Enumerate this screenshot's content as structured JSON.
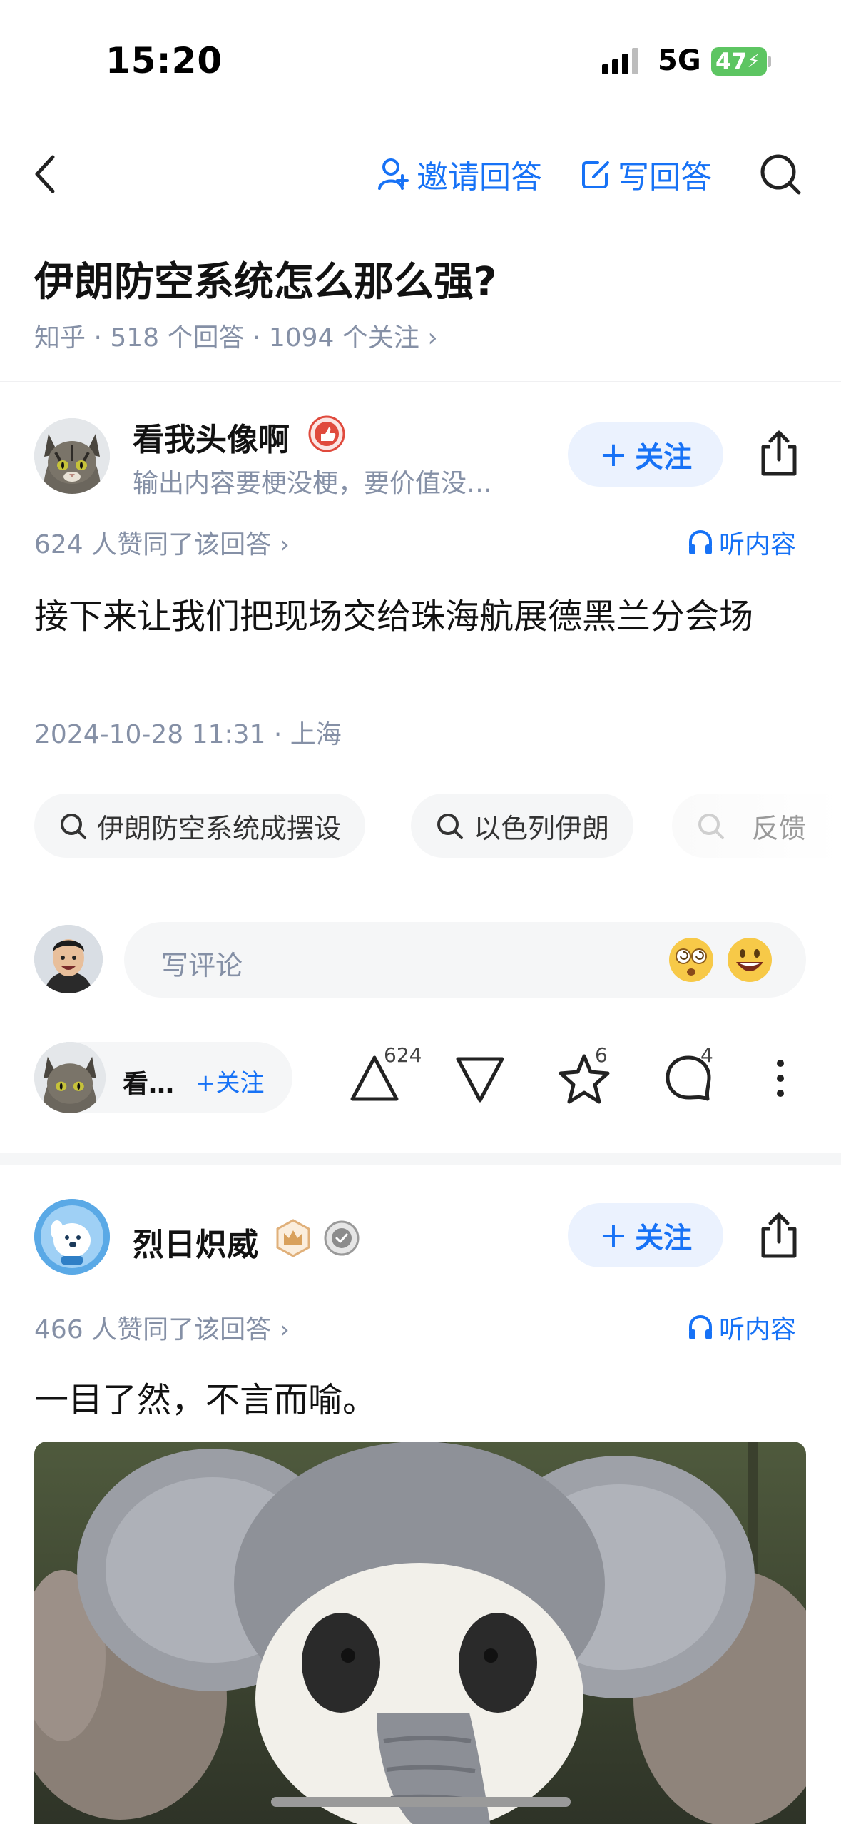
{
  "status_bar": {
    "time": "15:20",
    "network": "5G",
    "battery": "47"
  },
  "nav": {
    "invite_label": "邀请回答",
    "write_label": "写回答"
  },
  "question": {
    "title": "伊朗防空系统怎么那么强?",
    "meta": "知乎 · 518 个回答 · 1094 个关注 ›"
  },
  "answer1": {
    "author": "看我头像啊",
    "bio": "输出内容要梗没梗，要价值没…",
    "follow_label": "关注",
    "agree_text": "624 人赞同了该回答 ›",
    "listen_label": "听内容",
    "content": "接下来让我们把现场交给珠海航展德黑兰分会场",
    "date": "2024-10-28 11:31 · 上海",
    "related_searches": [
      "伊朗防空系统成摆设",
      "以色列伊朗",
      "反馈"
    ],
    "comment_placeholder": "写评论",
    "bottom_author_short": "看…",
    "bottom_follow_label": "+关注",
    "upvote_count": "624",
    "favorite_count": "6",
    "comment_count": "4"
  },
  "answer2": {
    "author": "烈日炽威",
    "follow_label": "关注",
    "agree_text": "466 人赞同了该回答 ›",
    "listen_label": "听内容",
    "content": "一目了然，不言而喻。"
  },
  "colors": {
    "accent": "#1772f6",
    "muted": "#8590a6",
    "follow_bg": "#ebf2fe"
  }
}
